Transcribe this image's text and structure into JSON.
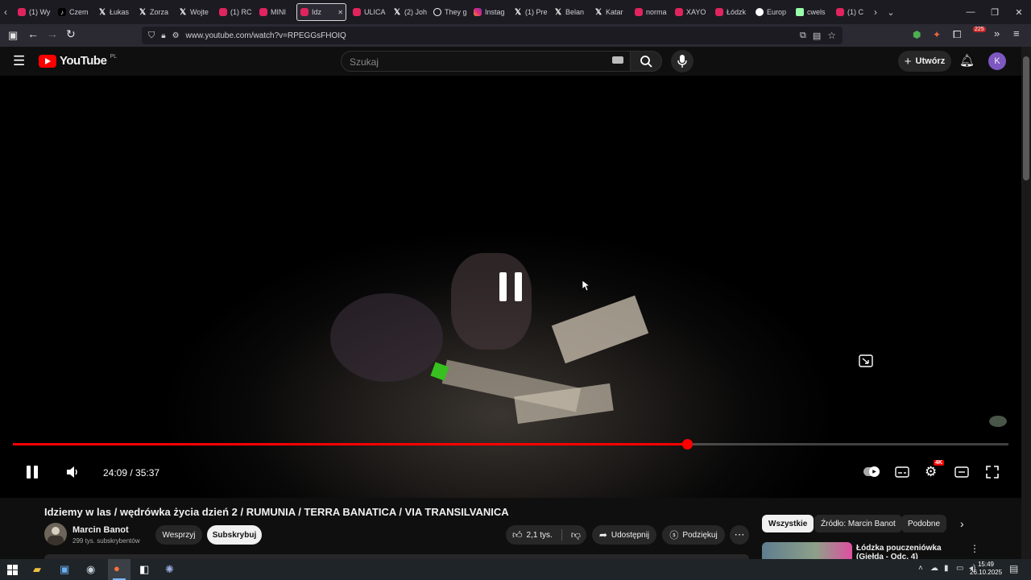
{
  "browser": {
    "tabs": [
      {
        "label": "(1) Wy",
        "icon": "youtube"
      },
      {
        "label": "Czem",
        "icon": "tiktok"
      },
      {
        "label": "Łukas",
        "icon": "x"
      },
      {
        "label": "Zorza",
        "icon": "x"
      },
      {
        "label": "Wojte",
        "icon": "x"
      },
      {
        "label": "(1) RC",
        "icon": "youtube"
      },
      {
        "label": "MINI",
        "icon": "youtube"
      },
      {
        "label": "Idz",
        "icon": "youtube",
        "active": true
      },
      {
        "label": "ULICA",
        "icon": "youtube"
      },
      {
        "label": "(2) Joh",
        "icon": "x"
      },
      {
        "label": "They g",
        "icon": "threads"
      },
      {
        "label": "Instag",
        "icon": "instagram"
      },
      {
        "label": "(1) Pre",
        "icon": "x"
      },
      {
        "label": "Belan",
        "icon": "x"
      },
      {
        "label": "Katar",
        "icon": "x"
      },
      {
        "label": "norma",
        "icon": "youtube"
      },
      {
        "label": "XAYO",
        "icon": "youtube"
      },
      {
        "label": "Łódzk",
        "icon": "youtube"
      },
      {
        "label": "Europ",
        "icon": "globe"
      },
      {
        "label": "cwels",
        "icon": "sheet"
      },
      {
        "label": "(1) C",
        "icon": "youtube"
      }
    ],
    "url": "www.youtube.com/watch?v=RPEGGsFHOIQ",
    "extension_badge": "225"
  },
  "youtube": {
    "logo_text": "YouTube",
    "region": "PL",
    "search_placeholder": "Szukaj",
    "create_label": "Utwórz",
    "avatar_letter": "K"
  },
  "player": {
    "time_current": "24:09",
    "time_total": "35:37",
    "time_display": "24:09 / 35:37",
    "progress_fraction": 0.677,
    "quality_badge": "4K",
    "state": "paused-indicator"
  },
  "video": {
    "title": "Idziemy w las / wędrówka życia dzień 2 / RUMUNIA / TERRA BANATICA / VIA TRANSILVANICA",
    "channel": "Marcin Banot",
    "subscribers": "299 tys. subskrybentów",
    "support_label": "Wesprzyj",
    "subscribe_label": "Subskrybuj",
    "likes": "2,1 tys.",
    "share_label": "Udostępnij",
    "thanks_label": "Podziękuj"
  },
  "sidebar": {
    "chips": [
      "Wszystkie",
      "Źródło: Marcin Banot",
      "Podobne"
    ],
    "first_item_title": "Łódzka pouczeniówka (Giełda - Odc. 4)"
  },
  "taskbar": {
    "time": "15:49",
    "date": "26.10.2025"
  },
  "colors": {
    "accent_red": "#ff0000",
    "background": "#0f0f0f",
    "chip_active_bg": "#f1f1f1"
  }
}
